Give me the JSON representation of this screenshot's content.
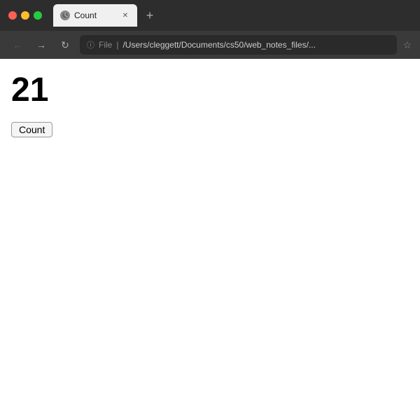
{
  "titlebar": {
    "traffic_lights": [
      "close",
      "minimize",
      "maximize"
    ],
    "tab": {
      "title": "Count",
      "close_symbol": "✕"
    },
    "new_tab_symbol": "+"
  },
  "navbar": {
    "back_symbol": "←",
    "forward_symbol": "→",
    "reload_symbol": "↻",
    "address": {
      "protocol": "File",
      "separator": "|",
      "url": "/Users/cleggett/Documents/cs50/web_notes_files/..."
    },
    "bookmark_symbol": "☆"
  },
  "page": {
    "counter_value": "21",
    "button_label": "Count"
  }
}
